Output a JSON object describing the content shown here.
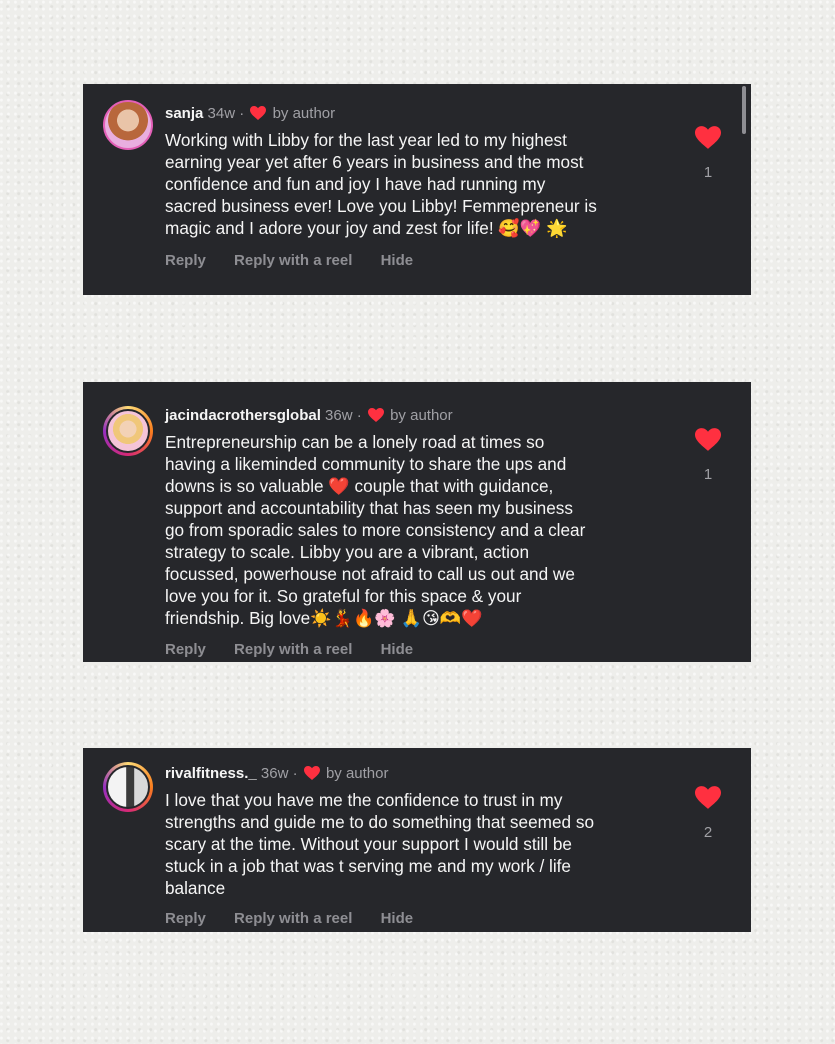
{
  "colors": {
    "heart": "#ff3040",
    "card_bg": "#26272b"
  },
  "comments": [
    {
      "username": "sanja",
      "age": "34w",
      "separator": "·",
      "by_author": "by author",
      "text": "Working with Libby for the last year led to my highest\nearning year yet after 6 years in business and the most\nconfidence and fun and joy I have had running my\nsacred business ever! Love you Libby! Femmepreneur is\nmagic and I adore your joy and zest for life! 🥰💖 🌟",
      "likes": "1",
      "reply": "Reply",
      "reply_reel": "Reply with a reel",
      "hide": "Hide"
    },
    {
      "username": "jacindacrothersglobal",
      "age": "36w",
      "separator": "·",
      "by_author": "by author",
      "text": "Entrepreneurship can be a lonely road at times so\nhaving a likeminded community to share the ups and\ndowns is so valuable ❤️ couple that with guidance,\nsupport and accountability that has seen my business\ngo from sporadic sales to more consistency and a clear\nstrategy to scale.  Libby you are a vibrant, action\nfocussed, powerhouse not afraid to call us out and we\nlove you for it.  So grateful for this space & your\nfriendship.  Big love☀️💃🔥🌸 🙏😘🫶❤️",
      "likes": "1",
      "reply": "Reply",
      "reply_reel": "Reply with a reel",
      "hide": "Hide"
    },
    {
      "username": "rivalfitness._",
      "age": "36w",
      "separator": "·",
      "by_author": "by author",
      "text": "I love that you have me the confidence to trust in my\nstrengths and guide me to do something that seemed so\nscary at the time. Without your support I would still be\nstuck in a job that was t serving me and my work / life\nbalance",
      "likes": "2",
      "reply": "Reply",
      "reply_reel": "Reply with a reel",
      "hide": "Hide"
    }
  ]
}
